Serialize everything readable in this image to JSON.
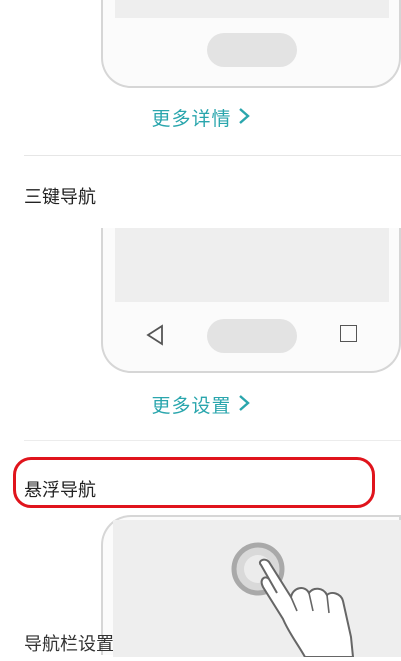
{
  "gesture_section": {
    "more_link": "更多详情",
    "chevron_icon": "chevron-right"
  },
  "three_key_section": {
    "title": "三键导航",
    "more_link": "更多设置",
    "chevron_icon": "chevron-right",
    "nav_icons": [
      "back-triangle-icon",
      "home-pill-icon",
      "recent-square-icon"
    ]
  },
  "floating_section": {
    "title": "悬浮导航",
    "highlight_color": "#e0141c",
    "icons": [
      "floating-dock-icon",
      "hand-pointer-icon"
    ]
  },
  "accent_color": "#2aa6ad",
  "bottom_cut_label": "导航栏设置"
}
